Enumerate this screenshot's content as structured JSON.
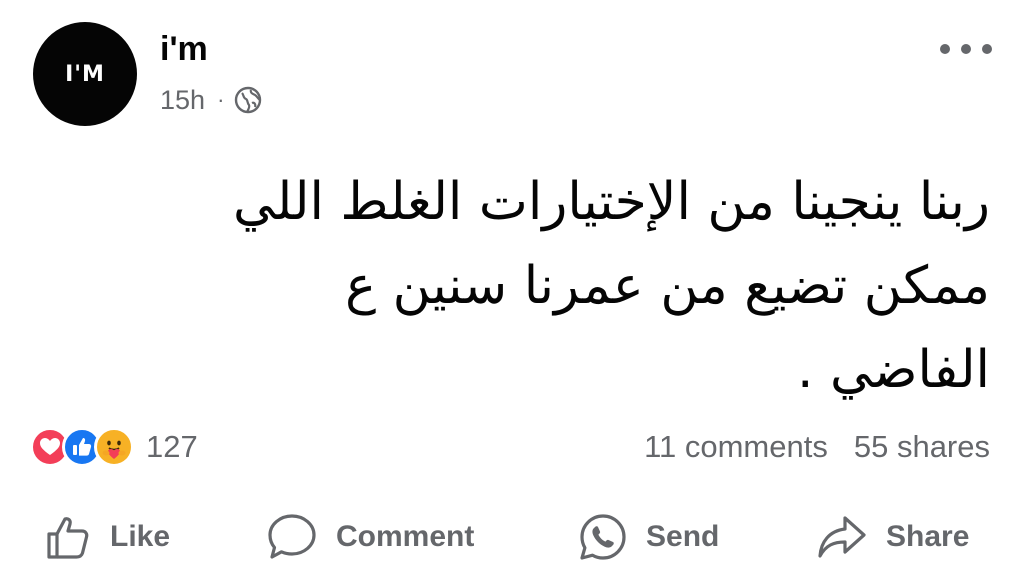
{
  "post": {
    "author": {
      "name": "i'm",
      "avatar_text": "I'M"
    },
    "time": "15h",
    "separator": "·",
    "privacy_icon": "globe-icon",
    "more_icon": "more-options-icon",
    "text_lines": [
      "ربنا ينجينا من الإختيارات الغلط اللي",
      "ممكن تضيع من عمرنا سنين ع",
      "الفاضي ."
    ]
  },
  "reactions": {
    "icons": [
      "love-icon",
      "like-icon",
      "care-icon"
    ],
    "count": "127"
  },
  "stats": {
    "comments": "11 comments",
    "shares": "55 shares"
  },
  "actions": {
    "like": "Like",
    "comment": "Comment",
    "send": "Send",
    "share": "Share"
  },
  "colors": {
    "text": "#050505",
    "secondary": "#65676b",
    "love": "#f33e58",
    "like": "#1877f2",
    "care": "#f7b125"
  }
}
